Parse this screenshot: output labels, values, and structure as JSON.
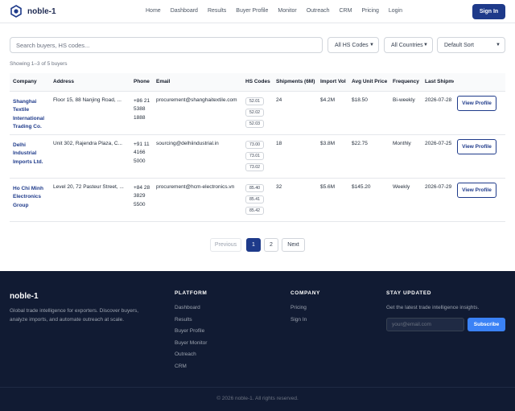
{
  "header": {
    "brand": "noble-1",
    "nav": [
      "Home",
      "Dashboard",
      "Results",
      "Buyer Profile",
      "Monitor",
      "Outreach",
      "CRM",
      "Pricing",
      "Login"
    ],
    "signin_label": "Sign In"
  },
  "filters": {
    "search_placeholder": "Search buyers, HS codes...",
    "hs_codes": "All HS Codes",
    "countries": "All Countries",
    "sort": "Default Sort"
  },
  "showing_text": "Showing 1–3 of 5 buyers",
  "table": {
    "columns": [
      "Company",
      "Address",
      "Phone",
      "Email",
      "HS Codes",
      "Shipments (6M)",
      "Import Vol",
      "Avg Unit Price",
      "Frequency",
      "Last Shipme"
    ],
    "rows": [
      {
        "company": "Shanghai Textile International Trading Co.",
        "address": "Floor 15, 88 Nanjing Road, ...",
        "phone": "+86 21 5388 1888",
        "email": "procurement@shanghaitextile.com",
        "hs_codes": [
          "52.01",
          "52.02",
          "52.03"
        ],
        "shipments": "24",
        "import_vol": "$4.2M",
        "avg_price": "$18.50",
        "frequency": "Bi-weekly",
        "last_shipment": "2026-07-28",
        "action": "View Profile"
      },
      {
        "company": "Delhi Industrial Imports Ltd.",
        "address": "Unit 302, Rajendra Plaza, C...",
        "phone": "+91 11 4166 5000",
        "email": "sourcing@delhiindustrial.in",
        "hs_codes": [
          "73.00",
          "73.01",
          "73.02"
        ],
        "shipments": "18",
        "import_vol": "$3.8M",
        "avg_price": "$22.75",
        "frequency": "Monthly",
        "last_shipment": "2026-07-25",
        "action": "View Profile"
      },
      {
        "company": "Ho Chi Minh Electronics Group",
        "address": "Level 20, 72 Pasteur Street, ...",
        "phone": "+84 28 3829 5500",
        "email": "procurement@hcm-electronics.vn",
        "hs_codes": [
          "85.40",
          "85.41",
          "85.42"
        ],
        "shipments": "32",
        "import_vol": "$5.6M",
        "avg_price": "$145.20",
        "frequency": "Weekly",
        "last_shipment": "2026-07-29",
        "action": "View Profile"
      }
    ]
  },
  "pagination": {
    "prev": "Previous",
    "pages": [
      "1",
      "2"
    ],
    "current": "1",
    "next": "Next"
  },
  "footer": {
    "brand": "noble-1",
    "description": "Global trade intelligence for exporters. Discover buyers, analyze imports, and automate outreach at scale.",
    "platform_heading": "PLATFORM",
    "platform_links": [
      "Dashboard",
      "Results",
      "Buyer Profile",
      "Buyer Monitor",
      "Outreach",
      "CRM"
    ],
    "company_heading": "COMPANY",
    "company_links": [
      "Pricing",
      "Sign In"
    ],
    "stay_heading": "STAY UPDATED",
    "stay_text": "Get the latest trade intelligence insights.",
    "email_placeholder": "your@email.com",
    "subscribe_label": "Subscribe",
    "copyright": "© 2026 noble-1. All rights reserved."
  },
  "colors": {
    "primary": "#1e3a8a",
    "footer_bg": "#111b33",
    "accent": "#3b82f6"
  }
}
